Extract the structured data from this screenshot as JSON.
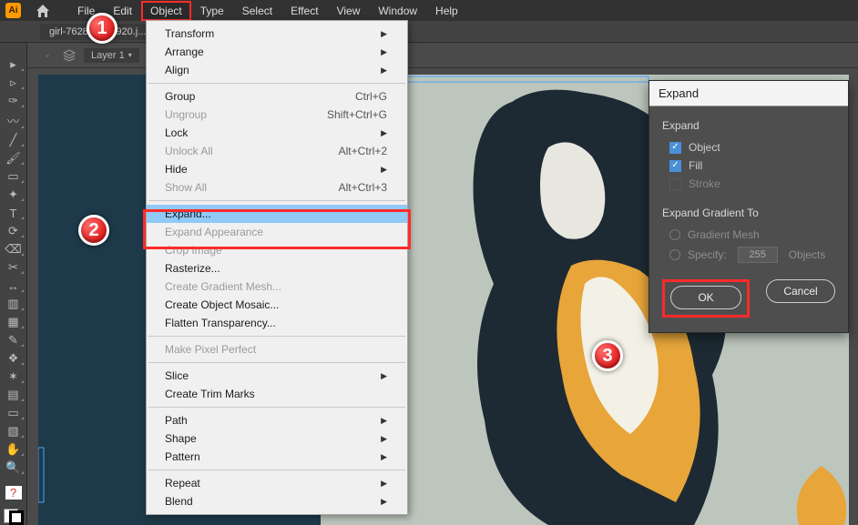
{
  "app": {
    "logo": "Ai"
  },
  "menubar": [
    "File",
    "Edit",
    "Object",
    "Type",
    "Select",
    "Effect",
    "View",
    "Window",
    "Help"
  ],
  "menubar_highlight_index": 2,
  "tab": {
    "label": "girl-7628308_1920.j..."
  },
  "layer_chip": "Layer 1",
  "dropdown": {
    "items": [
      {
        "label": "Transform",
        "submenu": true
      },
      {
        "label": "Arrange",
        "submenu": true
      },
      {
        "label": "Align",
        "submenu": true
      },
      {
        "sep": true
      },
      {
        "label": "Group",
        "shortcut": "Ctrl+G"
      },
      {
        "label": "Ungroup",
        "shortcut": "Shift+Ctrl+G",
        "disabled": true
      },
      {
        "label": "Lock",
        "submenu": true
      },
      {
        "label": "Unlock All",
        "shortcut": "Alt+Ctrl+2",
        "disabled": true
      },
      {
        "label": "Hide",
        "submenu": true
      },
      {
        "label": "Show All",
        "shortcut": "Alt+Ctrl+3",
        "disabled": true
      },
      {
        "sep": true
      },
      {
        "label": "Expand...",
        "highlight": true
      },
      {
        "label": "Expand Appearance",
        "disabled": true
      },
      {
        "label": "Crop Image",
        "disabled": true
      },
      {
        "label": "Rasterize..."
      },
      {
        "label": "Create Gradient Mesh...",
        "disabled": true
      },
      {
        "label": "Create Object Mosaic..."
      },
      {
        "label": "Flatten Transparency..."
      },
      {
        "sep": true
      },
      {
        "label": "Make Pixel Perfect",
        "disabled": true
      },
      {
        "sep": true
      },
      {
        "label": "Slice",
        "submenu": true
      },
      {
        "label": "Create Trim Marks"
      },
      {
        "sep": true
      },
      {
        "label": "Path",
        "submenu": true
      },
      {
        "label": "Shape",
        "submenu": true
      },
      {
        "label": "Pattern",
        "submenu": true
      },
      {
        "sep": true
      },
      {
        "label": "Repeat",
        "submenu": true
      },
      {
        "label": "Blend",
        "submenu": true
      }
    ]
  },
  "dialog": {
    "title": "Expand",
    "section1_label": "Expand",
    "object_label": "Object",
    "fill_label": "Fill",
    "stroke_label": "Stroke",
    "section2_label": "Expand Gradient To",
    "gradient_mesh_label": "Gradient Mesh",
    "specify_label": "Specify:",
    "specify_value": "255",
    "objects_label": "Objects",
    "ok_label": "OK",
    "cancel_label": "Cancel"
  },
  "callouts": {
    "c1": "1",
    "c2": "2",
    "c3": "3"
  },
  "tool_names": [
    "selection",
    "direct-selection",
    "pen",
    "curvature",
    "line",
    "paintbrush",
    "rect",
    "shaper",
    "text",
    "rotate",
    "eraser",
    "scissors",
    "width",
    "gradient",
    "mesh",
    "eyedropper",
    "blend",
    "symbol-sprayer",
    "column-graph",
    "artboard",
    "slice",
    "hand",
    "zoom"
  ]
}
